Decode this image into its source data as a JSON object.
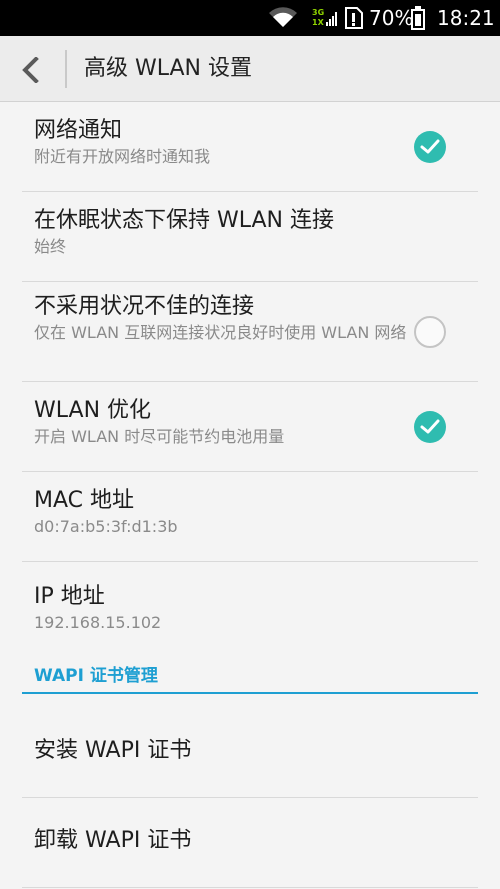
{
  "status_bar": {
    "net_top": "3G",
    "net_bottom": "1X",
    "battery_percent": "70%",
    "battery_level": 0.7,
    "time": "18:21",
    "icons": [
      "wifi-icon",
      "signal-icon",
      "sim-icon",
      "battery-icon"
    ]
  },
  "app_bar": {
    "back_icon": "chevron-left-icon",
    "title": "高级 WLAN 设置"
  },
  "settings": [
    {
      "title": "网络通知",
      "summary": "附近有开放网络时通知我",
      "checked": true
    },
    {
      "title": "在休眠状态下保持 WLAN 连接",
      "summary": "始终"
    },
    {
      "title": "不采用状况不佳的连接",
      "summary": "仅在 WLAN 互联网连接状况良好时使用 WLAN 网络",
      "checked": false
    },
    {
      "title": "WLAN 优化",
      "summary": "开启 WLAN 时尽可能节约电池用量",
      "checked": true
    },
    {
      "title": "MAC 地址",
      "summary": "d0:7a:b5:3f:d1:3b"
    },
    {
      "title": "IP 地址",
      "summary": "192.168.15.102"
    }
  ],
  "wapi": {
    "header": "WAPI 证书管理",
    "items": [
      {
        "title": "安装 WAPI 证书"
      },
      {
        "title": "卸载 WAPI 证书"
      }
    ]
  },
  "colors": {
    "accent": "#1e9fd2",
    "checkbox_on": "#2fbcb0",
    "background": "#f4f4f4",
    "status_bar": "#000000"
  }
}
